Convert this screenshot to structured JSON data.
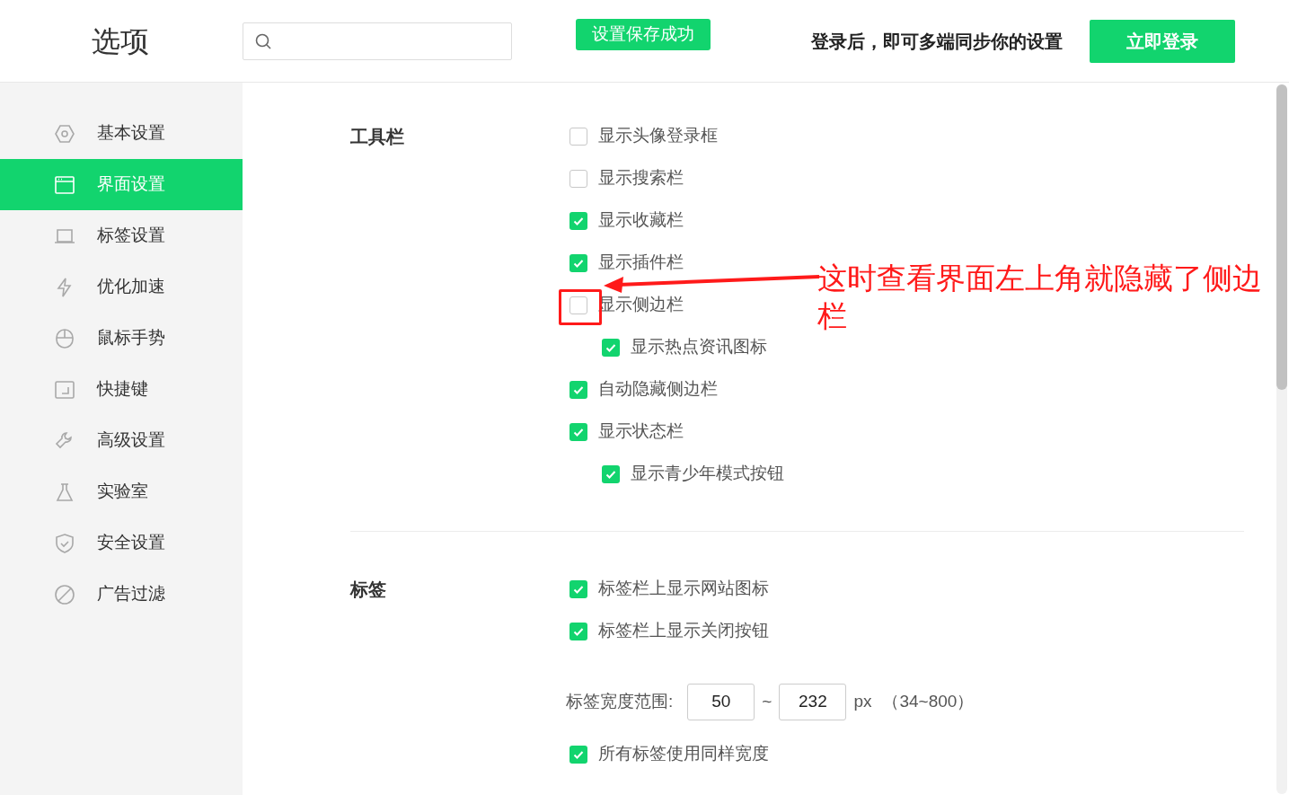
{
  "header": {
    "title": "选项",
    "toast": "设置保存成功",
    "login_hint": "登录后，即可多端同步你的设置",
    "login_button": "立即登录"
  },
  "sidebar": {
    "items": [
      {
        "label": "基本设置",
        "selected": false
      },
      {
        "label": "界面设置",
        "selected": true
      },
      {
        "label": "标签设置",
        "selected": false
      },
      {
        "label": "优化加速",
        "selected": false
      },
      {
        "label": "鼠标手势",
        "selected": false
      },
      {
        "label": "快捷键",
        "selected": false
      },
      {
        "label": "高级设置",
        "selected": false
      },
      {
        "label": "实验室",
        "selected": false
      },
      {
        "label": "安全设置",
        "selected": false
      },
      {
        "label": "广告过滤",
        "selected": false
      }
    ]
  },
  "sections": [
    {
      "title": "工具栏",
      "items": [
        {
          "kind": "checkbox",
          "label": "显示头像登录框",
          "checked": false
        },
        {
          "kind": "checkbox",
          "label": "显示搜索栏",
          "checked": false
        },
        {
          "kind": "checkbox",
          "label": "显示收藏栏",
          "checked": true
        },
        {
          "kind": "checkbox",
          "label": "显示插件栏",
          "checked": true
        },
        {
          "kind": "checkbox",
          "label": "显示侧边栏",
          "checked": false,
          "highlighted": true,
          "children": [
            {
              "kind": "checkbox",
              "label": "显示热点资讯图标",
              "checked": true
            }
          ]
        },
        {
          "kind": "checkbox",
          "label": "自动隐藏侧边栏",
          "checked": true
        },
        {
          "kind": "checkbox",
          "label": "显示状态栏",
          "checked": true,
          "children": [
            {
              "kind": "checkbox",
              "label": "显示青少年模式按钮",
              "checked": true
            }
          ]
        }
      ]
    },
    {
      "title": "标签",
      "items": [
        {
          "kind": "checkbox",
          "label": "标签栏上显示网站图标",
          "checked": true
        },
        {
          "kind": "checkbox",
          "label": "标签栏上显示关闭按钮",
          "checked": true
        },
        {
          "kind": "range",
          "label": "标签宽度范围:",
          "min": "50",
          "separator": "~",
          "max": "232",
          "unit": "px",
          "hint": "（34~800）"
        },
        {
          "kind": "checkbox",
          "label": "所有标签使用同样宽度",
          "checked": true
        }
      ]
    }
  ],
  "annotation": {
    "text": "这时查看界面左上角就隐藏了侧边栏"
  }
}
